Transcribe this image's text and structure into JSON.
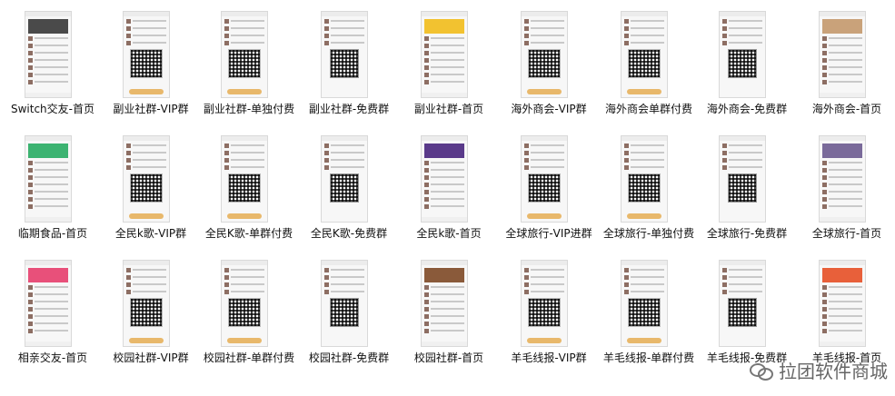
{
  "files": [
    {
      "label": "Switch交友-首页",
      "kind": "home",
      "banner": "#4a4a4a"
    },
    {
      "label": "副业社群-VIP群",
      "kind": "vip"
    },
    {
      "label": "副业社群-单独付费",
      "kind": "vip"
    },
    {
      "label": "副业社群-免费群",
      "kind": "free"
    },
    {
      "label": "副业社群-首页",
      "kind": "home",
      "banner": "#f2c230"
    },
    {
      "label": "海外商会-VIP群",
      "kind": "vip"
    },
    {
      "label": "海外商会单群付费",
      "kind": "vip"
    },
    {
      "label": "海外商会-免费群",
      "kind": "free"
    },
    {
      "label": "海外商会-首页",
      "kind": "home",
      "banner": "#c9a27a"
    },
    {
      "label": "临期食品-首页",
      "kind": "home",
      "banner": "#3cb371"
    },
    {
      "label": "全民k歌-VIP群",
      "kind": "vip"
    },
    {
      "label": "全民K歌-单群付费",
      "kind": "vip"
    },
    {
      "label": "全民K歌-免费群",
      "kind": "free"
    },
    {
      "label": "全民k歌-首页",
      "kind": "home",
      "banner": "#5a3a8a"
    },
    {
      "label": "全球旅行-VIP进群",
      "kind": "vip"
    },
    {
      "label": "全球旅行-单独付费",
      "kind": "vip"
    },
    {
      "label": "全球旅行-免费群",
      "kind": "free"
    },
    {
      "label": "全球旅行-首页",
      "kind": "home",
      "banner": "#7a6a9a"
    },
    {
      "label": "相亲交友-首页",
      "kind": "home",
      "banner": "#e8507a"
    },
    {
      "label": "校园社群-VIP群",
      "kind": "vip"
    },
    {
      "label": "校园社群-单群付费",
      "kind": "vip"
    },
    {
      "label": "校园社群-免费群",
      "kind": "free"
    },
    {
      "label": "校园社群-首页",
      "kind": "home",
      "banner": "#8a5a3a"
    },
    {
      "label": "羊毛线报-VIP群",
      "kind": "vip"
    },
    {
      "label": "羊毛线报-单群付费",
      "kind": "vip"
    },
    {
      "label": "羊毛线报-免费群",
      "kind": "free"
    },
    {
      "label": "羊毛线报-首页",
      "kind": "home",
      "banner": "#e8603a"
    }
  ],
  "watermark": {
    "text": "拉团软件商城",
    "icon": "wechat-icon"
  }
}
